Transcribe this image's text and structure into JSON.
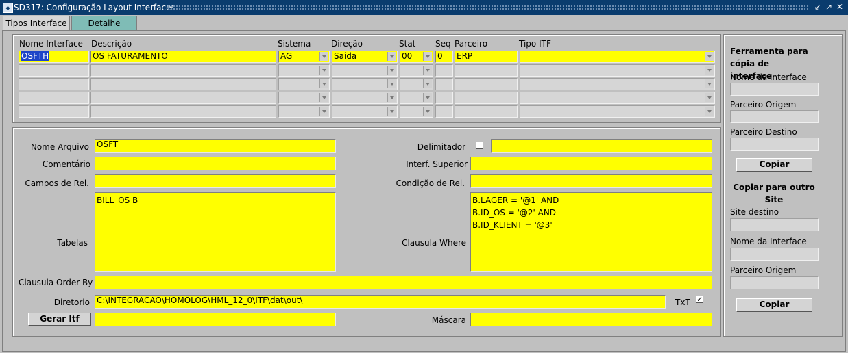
{
  "window": {
    "title": "SD317: Configuração Layout Interfaces",
    "icon": "app-icon"
  },
  "tabs": [
    {
      "label": "Tipos Interface",
      "active": true
    },
    {
      "label": "Detalhe",
      "active": false
    }
  ],
  "grid": {
    "headers": {
      "nome": "Nome Interface",
      "descricao": "Descrição",
      "sistema": "Sistema",
      "direcao": "Direção",
      "stat": "Stat",
      "seq": "Seq",
      "parceiro": "Parceiro",
      "tipo": "Tipo ITF"
    },
    "row": {
      "nome": "OSFTH",
      "descricao": "OS FATURAMENTO",
      "sistema": "AG",
      "direcao": "Saida",
      "stat": "00",
      "seq": "0",
      "parceiro": "ERP",
      "tipo": ""
    }
  },
  "detail": {
    "nome_arquivo_label": "Nome Arquivo",
    "nome_arquivo": "OSFT",
    "comentario_label": "Comentário",
    "comentario": "",
    "campos_rel_label": "Campos de Rel.",
    "campos_rel": "",
    "tabelas_label": "Tabelas",
    "tabelas": "BILL_OS B",
    "order_by_label": "Clausula Order By",
    "order_by": "",
    "diretorio_label": "Diretorio",
    "diretorio": "C:\\INTEGRACAO\\HOMOLOG\\HML_12_0\\ITF\\dat\\out\\",
    "txt_label": "TxT",
    "txt_checked": true,
    "gerar_label": "Gerar Itf",
    "gerar_value": "",
    "delimitador_label": "Delimitador",
    "delimitador": "",
    "interf_sup_label": "Interf. Superior",
    "interf_sup": "",
    "condicao_label": "Condição de Rel.",
    "condicao": "",
    "where_label": "Clausula Where",
    "where": "B.LAGER = '@1' AND\nB.ID_OS = '@2' AND\nB.ID_KLIENT = '@3'",
    "mascara_label": "Máscara",
    "mascara": ""
  },
  "side": {
    "tool_title": "Ferramenta para cópia de interface",
    "nome_label": "Nome da Interface",
    "origem_label": "Parceiro Origem",
    "destino_label": "Parceiro Destino",
    "copiar1": "Copiar",
    "site_title": "Copiar para outro Site",
    "site_label": "Site destino",
    "nome2_label": "Nome da Interface",
    "origem2_label": "Parceiro Origem",
    "copiar2": "Copiar"
  },
  "colors": {
    "field_yellow": "#ffff00",
    "titlebar": "#0a3c6e",
    "tab_detail": "#7fbcb6"
  }
}
